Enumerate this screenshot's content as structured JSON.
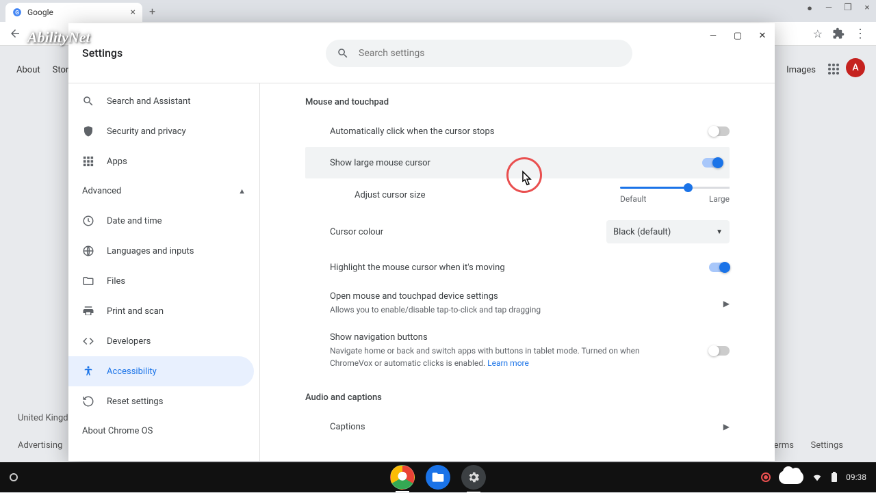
{
  "browser": {
    "tab_title": "Google",
    "images_link": "Images",
    "bg_about": "About",
    "bg_store": "Store",
    "bg_uk": "United Kingdom",
    "bg_adv": "Advertising",
    "bg_terms": "Terms",
    "bg_settings": "Settings",
    "avatar_letter": "A"
  },
  "watermark": "AbilityNet",
  "settings": {
    "title": "Settings",
    "search_placeholder": "Search settings",
    "sidebar": {
      "search_assistant": "Search and Assistant",
      "security": "Security and privacy",
      "apps": "Apps",
      "advanced": "Advanced",
      "date_time": "Date and time",
      "languages": "Languages and inputs",
      "files": "Files",
      "print_scan": "Print and scan",
      "developers": "Developers",
      "accessibility": "Accessibility",
      "reset": "Reset settings",
      "about": "About Chrome OS"
    },
    "content": {
      "section_mouse": "Mouse and touchpad",
      "auto_click": "Automatically click when the cursor stops",
      "large_cursor": "Show large mouse cursor",
      "adjust_size": "Adjust cursor size",
      "slider_default": "Default",
      "slider_large": "Large",
      "cursor_colour": "Cursor colour",
      "colour_value": "Black (default)",
      "highlight_moving": "Highlight the mouse cursor when it's moving",
      "open_device": "Open mouse and touchpad device settings",
      "open_device_sub": "Allows you to enable/disable tap-to-click and tap dragging",
      "nav_buttons": "Show navigation buttons",
      "nav_buttons_sub": "Navigate home or back and switch apps with buttons in tablet mode. Turned on when ChromeVox or automatic clicks is enabled.  ",
      "learn_more": "Learn more",
      "section_audio": "Audio and captions",
      "captions": "Captions"
    }
  },
  "taskbar": {
    "time": "09:38"
  }
}
